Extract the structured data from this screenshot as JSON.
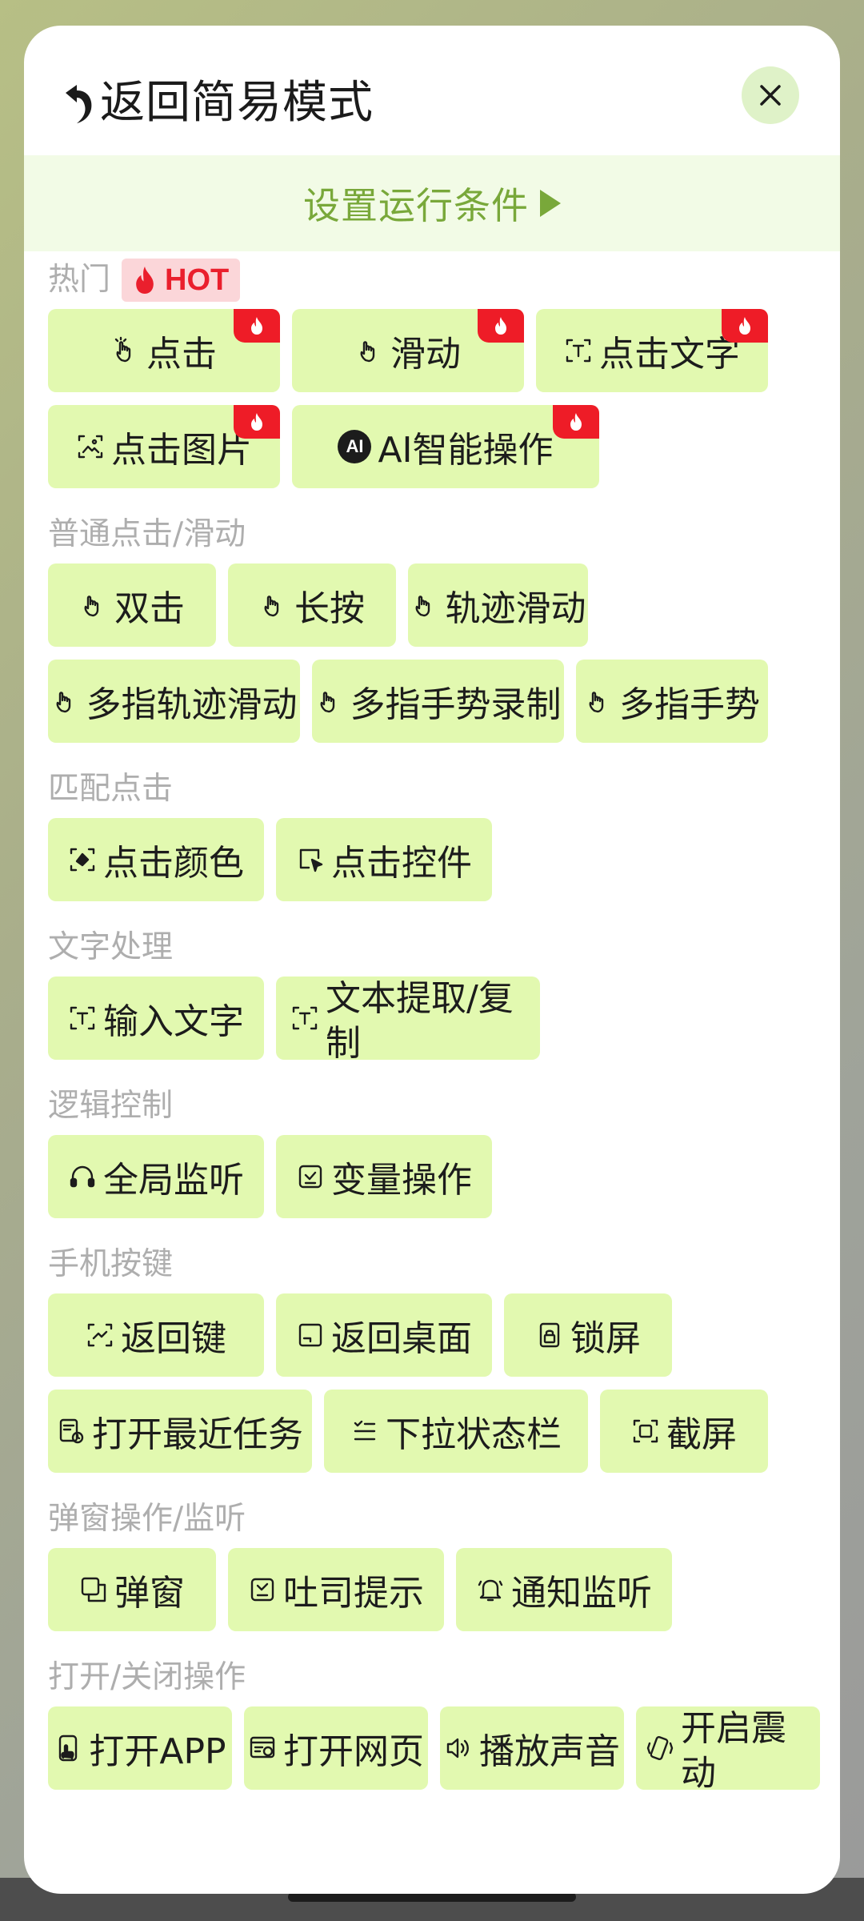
{
  "header": {
    "title": "返回简易模式",
    "back_icon": "undo-arrow-icon",
    "close_icon": "close-icon"
  },
  "condition_bar": {
    "label": "设置运行条件"
  },
  "colors": {
    "accent_green": "#79a83a",
    "chip_bg": "#e2f9b0",
    "hot_red": "#ea1f2d",
    "sheet_bg": "#ffffff"
  },
  "sections": [
    {
      "title": "热门",
      "badge": "HOT",
      "items": [
        {
          "label": "点击",
          "icon": "tap-hand-icon",
          "hot": true
        },
        {
          "label": "滑动",
          "icon": "swipe-hand-icon",
          "hot": true
        },
        {
          "label": "点击文字",
          "icon": "text-scan-icon",
          "hot": true
        },
        {
          "label": "点击图片",
          "icon": "image-scan-icon",
          "hot": true
        },
        {
          "label": "AI智能操作",
          "icon": "ai-icon",
          "icon_text": "AI",
          "hot": true
        }
      ]
    },
    {
      "title": "普通点击/滑动",
      "items": [
        {
          "label": "双击",
          "icon": "double-tap-icon"
        },
        {
          "label": "长按",
          "icon": "long-press-icon"
        },
        {
          "label": "轨迹滑动",
          "icon": "track-swipe-icon"
        },
        {
          "label": "多指轨迹滑动",
          "icon": "multi-finger-track-icon"
        },
        {
          "label": "多指手势录制",
          "icon": "multi-finger-record-icon"
        },
        {
          "label": "多指手势",
          "icon": "multi-finger-gesture-icon"
        }
      ]
    },
    {
      "title": "匹配点击",
      "items": [
        {
          "label": "点击颜色",
          "icon": "color-picker-icon"
        },
        {
          "label": "点击控件",
          "icon": "widget-cursor-icon"
        }
      ]
    },
    {
      "title": "文字处理",
      "items": [
        {
          "label": "输入文字",
          "icon": "text-input-icon"
        },
        {
          "label": "文本提取/复制",
          "icon": "text-extract-icon"
        }
      ]
    },
    {
      "title": "逻辑控制",
      "items": [
        {
          "label": "全局监听",
          "icon": "headphones-icon"
        },
        {
          "label": "变量操作",
          "icon": "variable-icon"
        }
      ]
    },
    {
      "title": "手机按键",
      "items": [
        {
          "label": "返回键",
          "icon": "back-key-icon"
        },
        {
          "label": "返回桌面",
          "icon": "home-icon"
        },
        {
          "label": "锁屏",
          "icon": "lock-screen-icon"
        },
        {
          "label": "打开最近任务",
          "icon": "recent-tasks-icon"
        },
        {
          "label": "下拉状态栏",
          "icon": "status-bar-icon"
        },
        {
          "label": "截屏",
          "icon": "screenshot-icon"
        }
      ]
    },
    {
      "title": "弹窗操作/监听",
      "items": [
        {
          "label": "弹窗",
          "icon": "popup-icon"
        },
        {
          "label": "吐司提示",
          "icon": "toast-icon"
        },
        {
          "label": "通知监听",
          "icon": "bell-icon"
        }
      ]
    },
    {
      "title": "打开/关闭操作",
      "items": [
        {
          "label": "打开APP",
          "icon": "open-app-icon"
        },
        {
          "label": "打开网页",
          "icon": "web-page-icon"
        },
        {
          "label": "播放声音",
          "icon": "speaker-icon"
        },
        {
          "label": "开启震动",
          "icon": "vibrate-icon"
        }
      ]
    }
  ]
}
